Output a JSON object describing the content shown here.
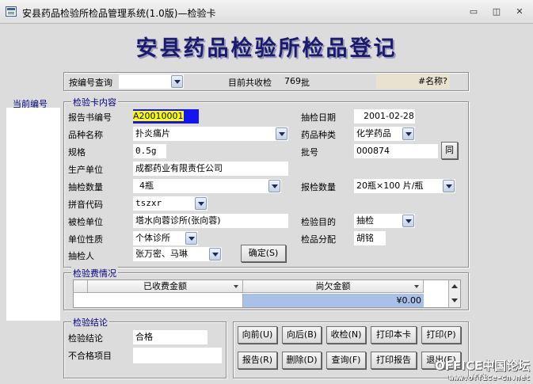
{
  "window": {
    "title": "安县药品检验所检品管理系统(1.0版)—检验卡",
    "minimize": "▭",
    "restore": "◫",
    "close": "✕"
  },
  "form": {
    "heading": "安县药品检验所检品登记"
  },
  "query": {
    "label": "按编号查询",
    "value": "",
    "count_label": "目前共收检",
    "count_value": "769",
    "count_unit": "批",
    "name_box": "#名称?"
  },
  "current_number": {
    "label": "当前编号"
  },
  "card": {
    "legend": "检验卡内容",
    "report_no_label": "报告书编号",
    "report_no": "A20010001",
    "date_label": "抽检日期",
    "date": "2001-02-28",
    "product_label": "品种名称",
    "product": "扑炎痛片",
    "category_label": "药品种类",
    "category": "化学药品",
    "spec_label": "规格",
    "spec": "0.5g",
    "batch_label": "批号",
    "batch": "000874",
    "same_button": "同",
    "maker_label": "生产单位",
    "maker": "成都药业有限责任公司",
    "sample_qty_label": "抽检数量",
    "sample_qty": "4瓶",
    "report_qty_label": "报检数量",
    "report_qty": "20瓶×100 片/瓶",
    "pinyin_label": "拼音代码",
    "pinyin": "tszxr",
    "inspected_label": "被检单位",
    "inspected": "塔水向蓉诊所(张向蓉)",
    "purpose_label": "检验目的",
    "purpose": "抽检",
    "unit_type_label": "单位性质",
    "unit_type": "个体诊所",
    "assign_label": "检品分配",
    "assign": "胡铭",
    "sampler_label": "抽检人",
    "sampler": "张万密、马琳",
    "confirm_button": "确定(S)"
  },
  "fees": {
    "legend": "检验费情况",
    "col_paid": "已收费金额",
    "col_owed": "尚欠金额",
    "paid": "",
    "owed": "¥0.00"
  },
  "conclusion": {
    "legend": "检验结论",
    "result_label": "检验结论",
    "result": "合格",
    "fail_label": "不合格项目",
    "fail": ""
  },
  "buttons": {
    "prev": "向前(U)",
    "next": "向后(B)",
    "receive": "收检(N)",
    "print_card": "打印本卡",
    "print": "打印(P)",
    "report": "报告(R)",
    "delete": "删除(D)",
    "query": "查询(F)",
    "print_report": "打印报告",
    "exit": "退出(E)"
  },
  "watermark": {
    "line1": "OFFICE中国论坛",
    "line2": "www.office-cn.net"
  }
}
